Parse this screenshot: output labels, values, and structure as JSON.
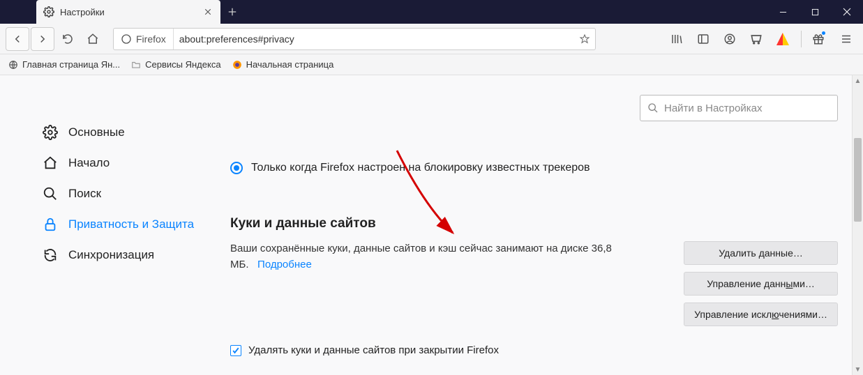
{
  "tab": {
    "title": "Настройки"
  },
  "url": {
    "identity": "Firefox",
    "value": "about:preferences#privacy"
  },
  "bookmarks": [
    {
      "label": "Главная страница Ян..."
    },
    {
      "label": "Сервисы Яндекса"
    },
    {
      "label": "Начальная страница"
    }
  ],
  "search": {
    "placeholder": "Найти в Настройках"
  },
  "sidebar": {
    "items": [
      {
        "label": "Основные"
      },
      {
        "label": "Начало"
      },
      {
        "label": "Поиск"
      },
      {
        "label": "Приватность и Защита"
      },
      {
        "label": "Синхронизация"
      }
    ]
  },
  "radio": {
    "label": "Только когда Firefox настроен на блокировку известных трекеров"
  },
  "cookies": {
    "heading": "Куки и данные сайтов",
    "desc_prefix": "Ваши сохранённые куки, данные сайтов и кэш сейчас занимают на диске ",
    "size": "36,8 МБ.",
    "more": "Подробнее",
    "checkbox_label": "Удалять куки и данные сайтов при закрытии Firefox",
    "buttons": {
      "clear": "Удалить данные…",
      "manage": "Управление данными…",
      "exceptions": "Управление исключениями…"
    }
  }
}
